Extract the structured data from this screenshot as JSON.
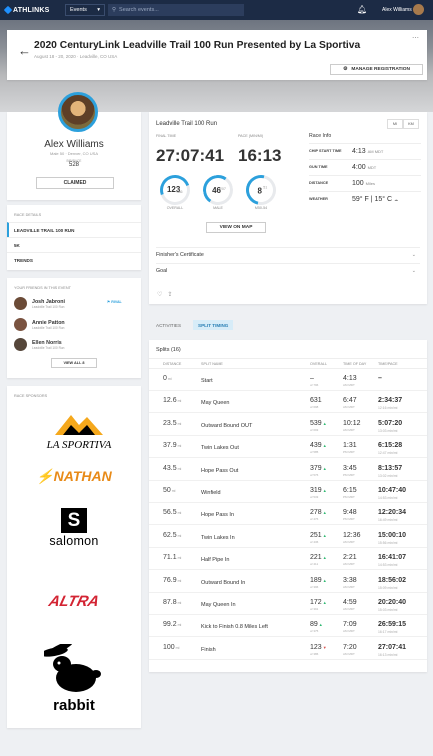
{
  "nav": {
    "logo": "ATHLINKS",
    "events_label": "Events",
    "search_placeholder": "Search events...",
    "user_name": "Alex Williams"
  },
  "event": {
    "title": "2020 CenturyLink Leadville Trail 100 Run Presented by La Sportiva",
    "date_location": "August 18 - 20, 2020  ·  Leadville, CO USA",
    "manage_label": "MANAGE REGISTRATION"
  },
  "profile": {
    "name": "Alex Williams",
    "info": "Male 50  ·  Denver, CO USA",
    "bib_label": "BIB/RACE",
    "bib": "528",
    "claimed_label": "CLAIMED"
  },
  "race_details": {
    "heading": "RACE DETAILS",
    "items": [
      "LEADVILLE TRAIL 100 RUN",
      "5K",
      "TRENDS"
    ]
  },
  "friends": {
    "heading": "YOUR FRIENDS IN THIS EVENT",
    "rival_label": "RIVAL",
    "items": [
      {
        "name": "Josh Jabroni",
        "event": "Leadville Trail 100 Run"
      },
      {
        "name": "Annie Patton",
        "event": "Leadville Trail 100 Run"
      },
      {
        "name": "Ellen Norris",
        "event": "Leadville Trail 100 Run"
      }
    ],
    "view_all": "VIEW ALL 8"
  },
  "sponsors": {
    "heading": "RACE SPONSORS",
    "logos": [
      "LA SPORTIVA",
      "NATHAN",
      "salomon",
      "ALTRA",
      "rabbit"
    ]
  },
  "result": {
    "race_name": "Leadville Trail 100 Run",
    "units": [
      "MI",
      "KM"
    ],
    "final_time_label": "FINAL TIME",
    "final_time": "27:07:41",
    "pace_label": "PACE (MIN/MI)",
    "pace": "16:13",
    "rings": [
      {
        "value": "123",
        "of": "386",
        "label": "OVERALL",
        "fill": 0.32
      },
      {
        "value": "46",
        "of": "207",
        "label": "MALE",
        "fill": 0.22
      },
      {
        "value": "8",
        "of": "51",
        "label": "M50-54",
        "fill": 0.16
      }
    ],
    "view_map": "VIEW ON MAP",
    "info_heading": "Race Info",
    "info": [
      {
        "key": "CHIP START TIME",
        "value": "4:13",
        "suffix": "AM MDT"
      },
      {
        "key": "GUN TIME",
        "value": "4:00",
        "suffix": "MDT"
      },
      {
        "key": "DISTANCE",
        "value": "100",
        "suffix": "Miles"
      },
      {
        "key": "WEATHER",
        "value": "59° F  |  15° C",
        "suffix": ""
      }
    ],
    "accordions": [
      "Finisher's Certificate",
      "Goal"
    ]
  },
  "tabs": [
    "ACTIVITIES",
    "SPLIT TIMING"
  ],
  "splits": {
    "title": "Splits (16)",
    "headers": [
      "DISTANCE",
      "SPLIT NAME",
      "OVERALL",
      "TIME OF DAY",
      "TIME/PACE"
    ],
    "rows": [
      {
        "dist": "0",
        "name": "Start",
        "overall": "–",
        "ovsub": "of 796",
        "dir": "",
        "tod": "4:13",
        "todsub": "AM MDT",
        "pace": "–",
        "pace2": "",
        "pace2sub": ""
      },
      {
        "dist": "12.6",
        "name": "May Queen",
        "overall": "631",
        "ovsub": "of 698",
        "dir": "",
        "tod": "6:47",
        "todsub": "AM MDT",
        "pace": "2:34:37",
        "pace2": "12:16",
        "pace2sub": "min/mi"
      },
      {
        "dist": "23.5",
        "name": "Outward Bound OUT",
        "overall": "539",
        "ovsub": "of 693",
        "dir": "up",
        "tod": "10:12",
        "todsub": "AM MDT",
        "pace": "5:07:20",
        "pace2": "13:03",
        "pace2sub": "min/mi"
      },
      {
        "dist": "37.9",
        "name": "Twin Lakes Out",
        "overall": "439",
        "ovsub": "of 585",
        "dir": "up",
        "tod": "1:31",
        "todsub": "PM MDT",
        "pace": "6:15:28",
        "pace2": "12:47",
        "pace2sub": "min/mi"
      },
      {
        "dist": "43.5",
        "name": "Hope Pass Out",
        "overall": "379",
        "ovsub": "of 576",
        "dir": "up",
        "tod": "3:45",
        "todsub": "PM MDT",
        "pace": "8:13:57",
        "pace2": "13:02",
        "pace2sub": "min/mi"
      },
      {
        "dist": "50",
        "name": "Winfield",
        "overall": "319",
        "ovsub": "of 533",
        "dir": "up",
        "tod": "6:15",
        "todsub": "PM MDT",
        "pace": "10:47:40",
        "pace2": "14:53",
        "pace2sub": "min/mi"
      },
      {
        "dist": "56.5",
        "name": "Hope Pass In",
        "overall": "278",
        "ovsub": "of 476",
        "dir": "up",
        "tod": "9:48",
        "todsub": "PM MDT",
        "pace": "12:20:34",
        "pace2": "16:49",
        "pace2sub": "min/mi"
      },
      {
        "dist": "62.5",
        "name": "Twin Lakes In",
        "overall": "251",
        "ovsub": "of 436",
        "dir": "up",
        "tod": "12:36",
        "todsub": "AM MDT",
        "pace": "15:00:10",
        "pace2": "15:56",
        "pace2sub": "min/mi"
      },
      {
        "dist": "71.1",
        "name": "Half Pipe In",
        "overall": "221",
        "ovsub": "of 411",
        "dir": "up",
        "tod": "2:21",
        "todsub": "AM MDT",
        "pace": "16:41:07",
        "pace2": "14:53",
        "pace2sub": "min/mi"
      },
      {
        "dist": "76.9",
        "name": "Outward Bound In",
        "overall": "189",
        "ovsub": "of 396",
        "dir": "up",
        "tod": "3:38",
        "todsub": "AM MDT",
        "pace": "18:56:02",
        "pace2": "15:09",
        "pace2sub": "min/mi"
      },
      {
        "dist": "87.8",
        "name": "May Queen In",
        "overall": "172",
        "ovsub": "of 391",
        "dir": "up",
        "tod": "4:59",
        "todsub": "AM MDT",
        "pace": "20:20:40",
        "pace2": "15:03",
        "pace2sub": "min/mi"
      },
      {
        "dist": "99.2",
        "name": "Kick to Finish 0.8 Miles Left",
        "overall": "89",
        "ovsub": "of 375",
        "dir": "up",
        "tod": "7:09",
        "todsub": "AM MDT",
        "pace": "26:59:15",
        "pace2": "16:17",
        "pace2sub": "min/mi"
      },
      {
        "dist": "100",
        "name": "Finish",
        "overall": "123",
        "ovsub": "of 386",
        "dir": "down",
        "tod": "7:20",
        "todsub": "AM MDT",
        "pace": "27:07:41",
        "pace2": "16:13",
        "pace2sub": "min/mi"
      }
    ]
  },
  "colors": {
    "accent": "#2ca0dc",
    "nav": "#1c2b45",
    "nathan": "#e88a17",
    "altra": "#d32433"
  }
}
